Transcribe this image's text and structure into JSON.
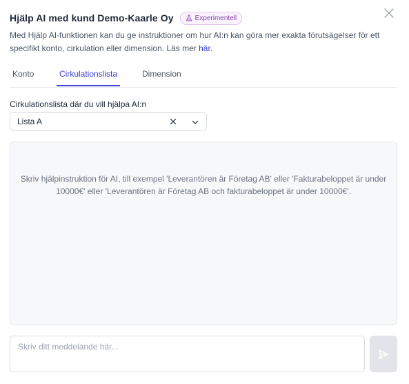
{
  "dialog": {
    "title": "Hjälp AI med kund Demo-Kaarle Oy",
    "badge": {
      "label": "Experimentell",
      "icon": "flask-icon",
      "color": "#8a46b0"
    },
    "close_icon": "close-icon",
    "description": "Med Hjälp AI-funktionen kan du ge instruktioner om hur AI:n kan göra mer exakta förutsägelser för ett specifikt konto, cirkulation eller dimension. Läs mer ",
    "description_link": "här",
    "description_end": "."
  },
  "tabs": [
    {
      "label": "Konto",
      "active": false
    },
    {
      "label": "Cirkulationslista",
      "active": true
    },
    {
      "label": "Dimension",
      "active": false
    }
  ],
  "accent_color": "#3b3fd8",
  "list_field": {
    "label": "Cirkulationslista där du vill hjälpa AI:n",
    "value": "Lista A",
    "clear_icon": "clear-icon",
    "dropdown_icon": "chevron-down-icon"
  },
  "chat": {
    "hint": "Skriv hjälpinstruktion för AI, till exempel 'Leverantören är Företag AB' eller 'Fakturabeloppet är under 10000€' eller 'Leverantören är Företag AB och fakturabeloppet är under 10000€'."
  },
  "composer": {
    "placeholder": "Skriv ditt meddelande här...",
    "value": "",
    "send_icon": "send-icon"
  }
}
